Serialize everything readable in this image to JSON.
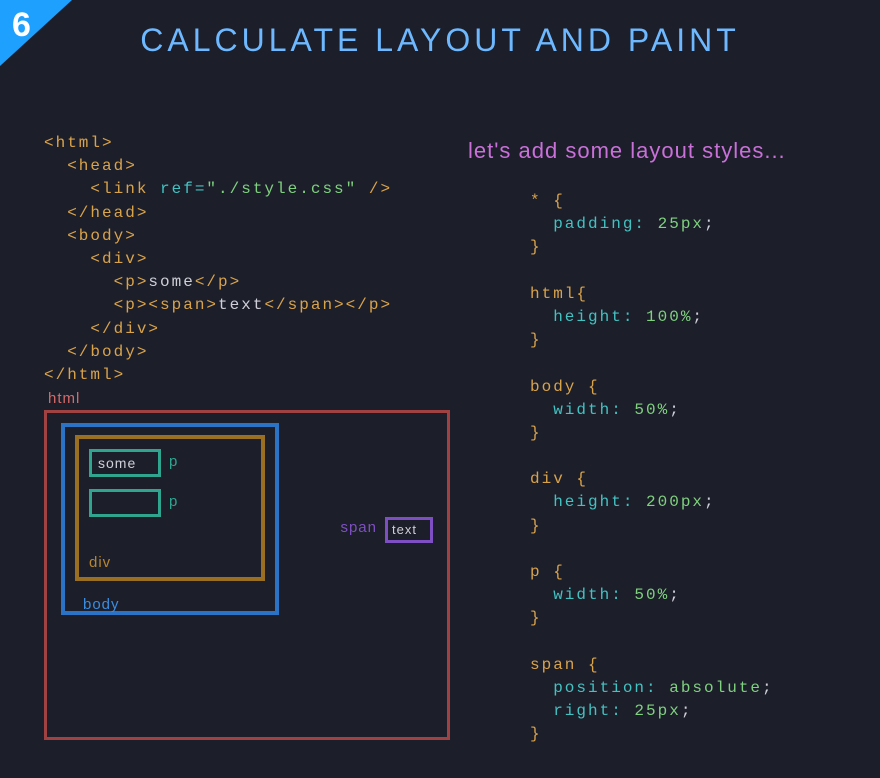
{
  "badge": "6",
  "title": "CALCULATE LAYOUT AND PAINT",
  "subhead": "let's add some layout styles...",
  "html_code": {
    "lines": [
      [
        [
          "tag",
          "<html>"
        ]
      ],
      [
        [
          "txt",
          "  "
        ],
        [
          "tag",
          "<head>"
        ]
      ],
      [
        [
          "txt",
          "    "
        ],
        [
          "tag",
          "<link "
        ],
        [
          "attr",
          "ref="
        ],
        [
          "val",
          "\"./style.css\""
        ],
        [
          "tag",
          " />"
        ]
      ],
      [
        [
          "txt",
          "  "
        ],
        [
          "tag",
          "</head>"
        ]
      ],
      [
        [
          "txt",
          "  "
        ],
        [
          "tag",
          "<body>"
        ]
      ],
      [
        [
          "txt",
          "    "
        ],
        [
          "tag",
          "<div>"
        ]
      ],
      [
        [
          "txt",
          "      "
        ],
        [
          "tag",
          "<p>"
        ],
        [
          "txt",
          "some"
        ],
        [
          "tag",
          "</p>"
        ]
      ],
      [
        [
          "txt",
          "      "
        ],
        [
          "tag",
          "<p><span>"
        ],
        [
          "txt",
          "text"
        ],
        [
          "tag",
          "</span></p>"
        ]
      ],
      [
        [
          "txt",
          "    "
        ],
        [
          "tag",
          "</div>"
        ]
      ],
      [
        [
          "txt",
          "  "
        ],
        [
          "tag",
          "</body>"
        ]
      ],
      [
        [
          "tag",
          "</html>"
        ]
      ]
    ]
  },
  "css_code": {
    "rules": [
      {
        "selector": "*",
        "decls": [
          [
            "padding",
            "25px"
          ]
        ]
      },
      {
        "selector": "html",
        "decls": [
          [
            "height",
            "100%"
          ]
        ]
      },
      {
        "selector": "body",
        "decls": [
          [
            "width",
            "50%"
          ]
        ]
      },
      {
        "selector": "div",
        "decls": [
          [
            "height",
            "200px"
          ]
        ]
      },
      {
        "selector": "p",
        "decls": [
          [
            "width",
            "50%"
          ]
        ]
      },
      {
        "selector": "span",
        "decls": [
          [
            "position",
            "absolute"
          ],
          [
            "right",
            "25px"
          ]
        ]
      }
    ]
  },
  "diagram": {
    "html": "html",
    "body": "body",
    "div": "div",
    "p": "p",
    "p1_text": "some",
    "span": "span",
    "span_text": "text"
  }
}
